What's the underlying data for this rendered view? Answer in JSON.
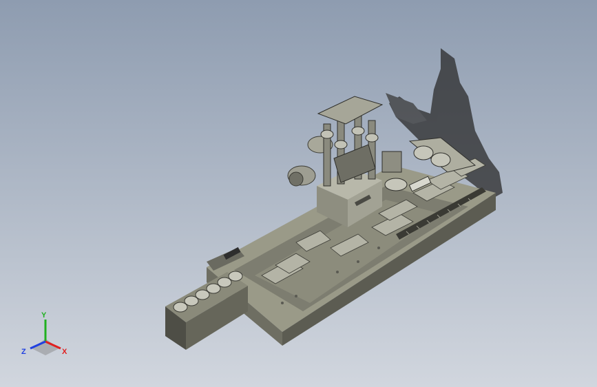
{
  "viewport": {
    "background_top": "#8e9cb0",
    "background_bottom": "#d1d6de"
  },
  "model": {
    "body_color": "#7a7a6e",
    "body_shadow_color": "#4a4a42",
    "shadow_color": "#2a2a2a"
  },
  "triad": {
    "x_label": "X",
    "y_label": "Y",
    "z_label": "Z",
    "x_color": "#e02020",
    "y_color": "#20b020",
    "z_color": "#2040e0"
  }
}
